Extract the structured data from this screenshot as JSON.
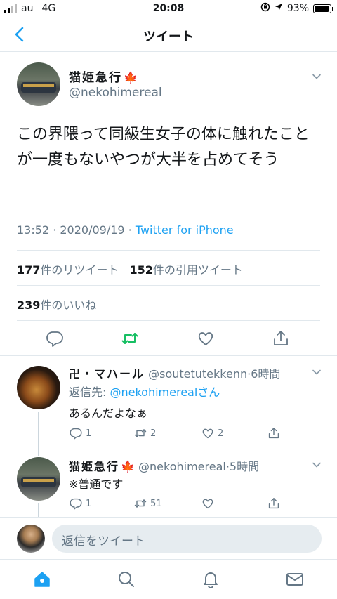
{
  "status": {
    "carrier": "au",
    "network": "4G",
    "time": "20:08",
    "battery": "93%",
    "battery_level": 0.93
  },
  "header": {
    "title": "ツイート",
    "back_icon": "chevron-left-icon"
  },
  "tweet": {
    "author_name": "猫姫急行",
    "author_emoji": "🍁",
    "author_handle": "@nekohimereal",
    "text": "この界隈って同級生女子の体に触れたことが一度もないやつが大半を占めてそう",
    "time": "13:52 · 2020/09/19 · ",
    "source": "Twitter for iPhone",
    "retweets": "177",
    "retweets_label": "件のリツイート",
    "quotes": "152",
    "quotes_label": "件の引用ツイート",
    "likes": "239",
    "likes_label": "件のいいね"
  },
  "replies": [
    {
      "name": "卍・マハール",
      "handle": "@soutetutekkenn",
      "time": "·6時間",
      "reply_to_label": "返信先: ",
      "reply_to": "@nekohimerealさん",
      "text": "あるんだよなぁ",
      "reply_count": "1",
      "retweet_count": "2",
      "like_count": "2"
    },
    {
      "name": "猫姫急行",
      "emoji": "🍁",
      "handle": "@nekohimereal",
      "time": "·5時間",
      "text": "※普通です",
      "reply_count": "1",
      "retweet_count": "51",
      "like_count": ""
    }
  ],
  "compose": {
    "placeholder": "返信をツイート"
  },
  "tabbar": [
    "home-icon",
    "search-icon",
    "notifications-icon",
    "messages-icon"
  ],
  "colors": {
    "accent": "#1da1f2",
    "retweet": "#17bf63",
    "muted": "#657786"
  }
}
